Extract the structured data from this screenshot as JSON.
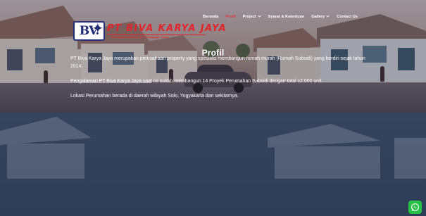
{
  "nav": {
    "items": [
      {
        "label": "Beranda",
        "has_dropdown": false,
        "active": false
      },
      {
        "label": "Profil",
        "has_dropdown": false,
        "active": true
      },
      {
        "label": "Project",
        "has_dropdown": true,
        "active": false
      },
      {
        "label": "Syarat & Ketentuan",
        "has_dropdown": false,
        "active": false
      },
      {
        "label": "Gallery",
        "has_dropdown": true,
        "active": false
      },
      {
        "label": "Contact Us",
        "has_dropdown": false,
        "active": false
      }
    ],
    "active_color": "#d63b3b"
  },
  "hero": {
    "title": "Profil"
  },
  "logo": {
    "mark": "BV.",
    "name": "PT BIVA KARYA JAYA",
    "tagline": "Developer, Kontraktor, dan Perdagangan Umum",
    "brand_red": "#e0262a",
    "brand_navy": "#232d74"
  },
  "content": {
    "paragraphs": [
      "PT Biva Karya Jaya merupakan perusahaan property yang spesialis membangun rumah murah (Rumah Subsidi) yang berdiri sejak tahun 2014.",
      "Pengalaman PT Biva Karya Jaya saat ini sudah membangun 14 Proyek Perumahan Subsidi dengan total ±2.000 unit",
      "Lokasi Perumahan berada di daerah wilayah Solo, Yogyakarta dan sekitarnya."
    ]
  },
  "whatsapp": {
    "icon": "whatsapp-icon",
    "color": "#27c049"
  }
}
